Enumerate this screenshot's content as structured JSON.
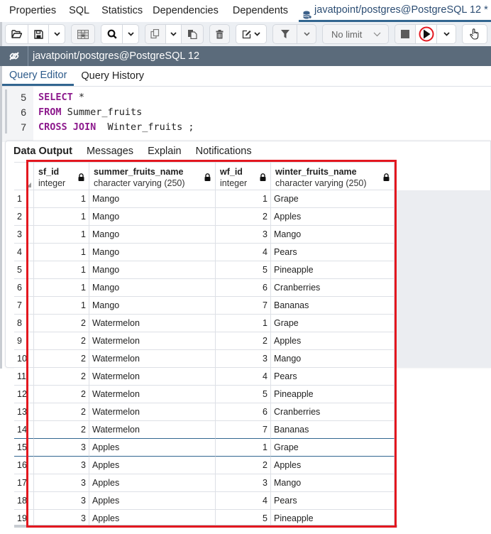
{
  "top_tabs": [
    "Properties",
    "SQL",
    "Statistics",
    "Dependencies",
    "Dependents"
  ],
  "active_tab": {
    "label": "javatpoint/postgres@PostgreSQL 12 *",
    "icon": "database-icon"
  },
  "toolbar": {
    "limit_select": {
      "value": "No limit"
    },
    "buttons": [
      {
        "name": "open-file",
        "icon": "folder-open-icon"
      },
      {
        "name": "save-file",
        "icon": "save-icon"
      },
      {
        "name": "save-dropdown",
        "icon": "chevron-down-icon"
      },
      {
        "name": "edit-data",
        "icon": "table-edit-icon"
      },
      {
        "name": "find",
        "icon": "search-icon"
      },
      {
        "name": "find-dropdown",
        "icon": "chevron-down-icon"
      },
      {
        "name": "copy",
        "icon": "copy-icon"
      },
      {
        "name": "copy-dropdown",
        "icon": "chevron-down-icon"
      },
      {
        "name": "paste",
        "icon": "paste-icon"
      },
      {
        "name": "delete",
        "icon": "trash-icon"
      },
      {
        "name": "edit",
        "icon": "edit-icon"
      },
      {
        "name": "filter",
        "icon": "filter-icon"
      },
      {
        "name": "filter-dropdown",
        "icon": "chevron-down-icon"
      },
      {
        "name": "stop",
        "icon": "stop-icon"
      },
      {
        "name": "execute",
        "icon": "play-icon"
      },
      {
        "name": "execute-dropdown",
        "icon": "chevron-down-icon"
      },
      {
        "name": "macros",
        "icon": "hand-pointer-icon"
      }
    ]
  },
  "panel": {
    "title": "javatpoint/postgres@PostgreSQL 12",
    "icon": "connection-icon"
  },
  "editor_tabs": [
    "Query Editor",
    "Query History"
  ],
  "editor_active_tab": "Query Editor",
  "code": [
    {
      "line": "5",
      "parts": [
        {
          "t": "SELECT",
          "kw": true
        },
        {
          "t": " *",
          "kw": false
        }
      ]
    },
    {
      "line": "6",
      "parts": [
        {
          "t": "FROM",
          "kw": true
        },
        {
          "t": " Summer_fruits",
          "kw": false
        }
      ]
    },
    {
      "line": "7",
      "parts": [
        {
          "t": "CROSS JOIN",
          "kw": true
        },
        {
          "t": "  Winter_fruits ;",
          "kw": false
        }
      ]
    }
  ],
  "result_tabs": [
    "Data Output",
    "Messages",
    "Explain",
    "Notifications"
  ],
  "result_active_tab": "Data Output",
  "columns": [
    {
      "name": "sf_id",
      "type": "integer"
    },
    {
      "name": "summer_fruits_name",
      "type": "character varying (250)"
    },
    {
      "name": "wf_id",
      "type": "integer"
    },
    {
      "name": "winter_fruits_name",
      "type": "character varying (250)"
    }
  ],
  "rows": [
    [
      "1",
      "1",
      "Mango",
      "1",
      "Grape"
    ],
    [
      "2",
      "1",
      "Mango",
      "2",
      "Apples"
    ],
    [
      "3",
      "1",
      "Mango",
      "3",
      "Mango"
    ],
    [
      "4",
      "1",
      "Mango",
      "4",
      "Pears"
    ],
    [
      "5",
      "1",
      "Mango",
      "5",
      "Pineapple"
    ],
    [
      "6",
      "1",
      "Mango",
      "6",
      "Cranberries"
    ],
    [
      "7",
      "1",
      "Mango",
      "7",
      "Bananas"
    ],
    [
      "8",
      "2",
      "Watermelon",
      "1",
      "Grape"
    ],
    [
      "9",
      "2",
      "Watermelon",
      "2",
      "Apples"
    ],
    [
      "10",
      "2",
      "Watermelon",
      "3",
      "Mango"
    ],
    [
      "11",
      "2",
      "Watermelon",
      "4",
      "Pears"
    ],
    [
      "12",
      "2",
      "Watermelon",
      "5",
      "Pineapple"
    ],
    [
      "13",
      "2",
      "Watermelon",
      "6",
      "Cranberries"
    ],
    [
      "14",
      "2",
      "Watermelon",
      "7",
      "Bananas"
    ],
    [
      "15",
      "3",
      "Apples",
      "1",
      "Grape"
    ],
    [
      "16",
      "3",
      "Apples",
      "2",
      "Apples"
    ],
    [
      "17",
      "3",
      "Apples",
      "3",
      "Mango"
    ],
    [
      "18",
      "3",
      "Apples",
      "4",
      "Pears"
    ],
    [
      "19",
      "3",
      "Apples",
      "5",
      "Pineapple"
    ]
  ],
  "selected_row": 15,
  "colors": {
    "accent": "#326690",
    "highlight_box": "#e3171f",
    "keyword": "#8d1a8d",
    "panel_bar": "#5b6b7b"
  }
}
